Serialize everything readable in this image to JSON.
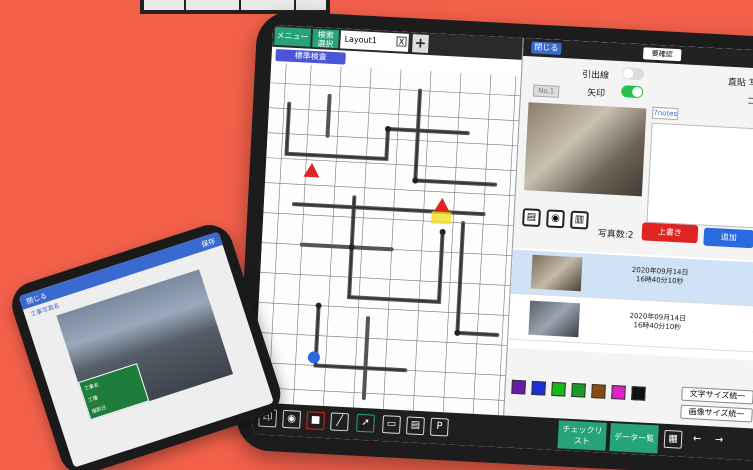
{
  "tablet": {
    "tabs": {
      "menu": "メニュー",
      "search": "検索\n選択",
      "layout": "Layout1",
      "close": "X",
      "add": "+"
    },
    "standard_check": "標準検査",
    "panel": {
      "close": "閉じる",
      "confirm": "要確認",
      "leader_line": "引出線",
      "arrow": "矢印",
      "direct_paste": "直貼 写",
      "comment": "コメ",
      "no_label": "No.1",
      "notes": "7notes",
      "black_label": "黒",
      "photo_count": "写真数:2",
      "overwrite": "上書き",
      "add": "追加",
      "photos": [
        {
          "date": "2020年09月14日",
          "time": "16時40分10秒"
        },
        {
          "date": "2020年09月14日",
          "time": "16時40分10秒"
        }
      ],
      "text_size": "文字サイズ統一",
      "image_size": "画像サイズ統一",
      "swatch_colors": [
        "#6a1aa8",
        "#1a2ee0",
        "#18b818",
        "#1a9a2a",
        "#8a4a10",
        "#e020c8",
        "#111111"
      ]
    },
    "toolbar": {
      "checklist": "チェックリ\nスト",
      "data_list": "データ一覧"
    }
  },
  "phone": {
    "close": "閉じる",
    "save": "保存",
    "subtitle": "工事写真名",
    "board_lines": [
      "工事名",
      "工種",
      "撮影日"
    ]
  }
}
